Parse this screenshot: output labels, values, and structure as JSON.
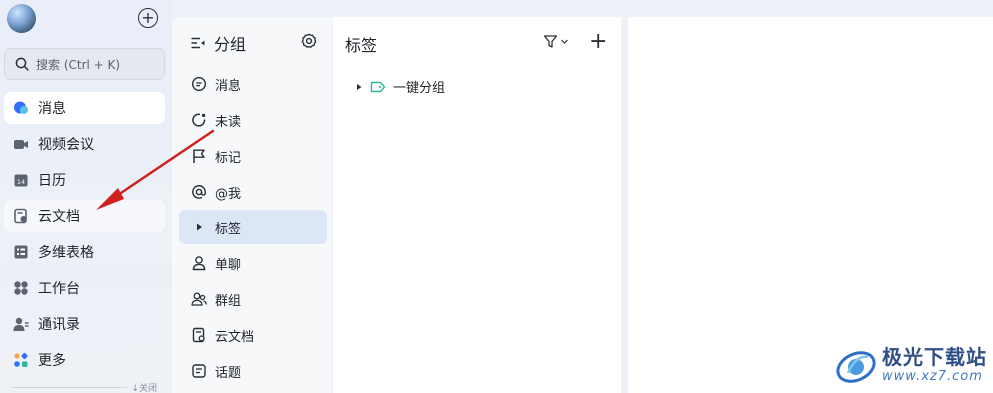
{
  "nav": {
    "search_placeholder": "搜索 (Ctrl + K)",
    "items": [
      {
        "label": "消息",
        "icon": "message-bubble-icon"
      },
      {
        "label": "视频会议",
        "icon": "video-camera-icon"
      },
      {
        "label": "日历",
        "icon": "calendar-icon"
      },
      {
        "label": "云文档",
        "icon": "cloud-doc-icon"
      },
      {
        "label": "多维表格",
        "icon": "table-icon"
      },
      {
        "label": "工作台",
        "icon": "workbench-icon"
      },
      {
        "label": "通讯录",
        "icon": "contacts-icon"
      },
      {
        "label": "更多",
        "icon": "more-apps-icon"
      }
    ],
    "calendar_day": "14",
    "collapse_label": "↓关闭"
  },
  "group_panel": {
    "title": "分组",
    "items": [
      {
        "label": "消息",
        "icon": "message-icon"
      },
      {
        "label": "未读",
        "icon": "unread-icon"
      },
      {
        "label": "标记",
        "icon": "flag-icon"
      },
      {
        "label": "@我",
        "icon": "at-icon"
      },
      {
        "label": "标签",
        "icon": "caret-right-icon"
      },
      {
        "label": "单聊",
        "icon": "person-icon"
      },
      {
        "label": "群组",
        "icon": "group-icon"
      },
      {
        "label": "云文档",
        "icon": "doc-icon"
      },
      {
        "label": "话题",
        "icon": "topic-icon"
      }
    ]
  },
  "tag_panel": {
    "title": "标签",
    "rows": [
      {
        "label": "一键分组"
      }
    ]
  },
  "watermark": {
    "title": "极光下载站",
    "url": "www.xz7.com"
  },
  "colors": {
    "accent": "#3370ff",
    "selected_bg": "#dde6f7",
    "tag_green": "#2eb6a0",
    "arrow_red": "#d0221f"
  }
}
